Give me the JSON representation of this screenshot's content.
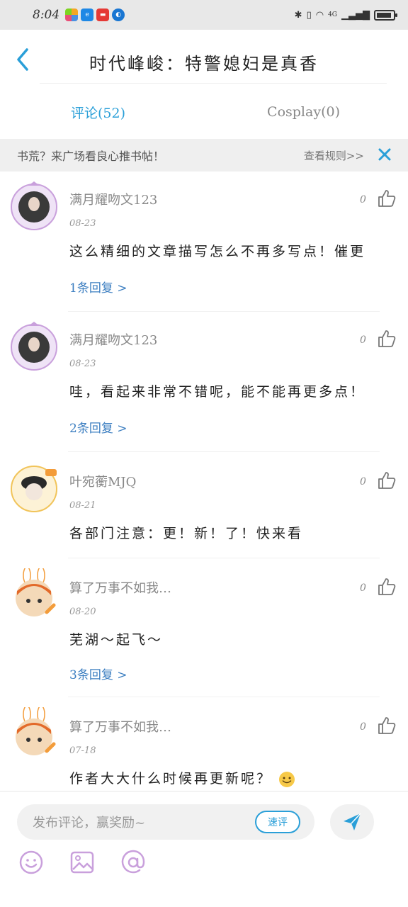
{
  "status_bar": {
    "time": "8:04",
    "network": "4G"
  },
  "header": {
    "title": "时代峰峻：特警媳妇是真香"
  },
  "tabs": [
    {
      "label": "评论(52)",
      "active": true
    },
    {
      "label": "Cosplay(0)",
      "active": false
    }
  ],
  "banner": {
    "text": "书荒？来广场看良心推书帖！",
    "rule_link": "查看规则>>"
  },
  "comments": [
    {
      "name": "满月耀吻文123",
      "date": "08-23",
      "text": "这么精细的文章描写怎么不再多写点！催更",
      "reply": "1条回复 >",
      "likes": "0"
    },
    {
      "name": "满月耀吻文123",
      "date": "08-23",
      "text": "哇，看起来非常不错呢，能不能再更多点！",
      "reply": "2条回复 >",
      "likes": "0"
    },
    {
      "name": "叶宛蘅MJQ",
      "date": "08-21",
      "text": "各部门注意：更！新！了！快来看",
      "reply": "",
      "likes": "0"
    },
    {
      "name": "算了万事不如我…",
      "date": "08-20",
      "text": "芜湖～起飞～",
      "reply": "3条回复 >",
      "likes": "0"
    },
    {
      "name": "算了万事不如我…",
      "date": "07-18",
      "text": "作者大大什么时候再更新呢？",
      "reply": "",
      "likes": "0"
    }
  ],
  "bottom_bar": {
    "input_placeholder": "发布评论，赢奖励~",
    "quick_comment": "速评"
  },
  "colors": {
    "accent": "#2a9fd8",
    "reply_link": "#3d7fc1",
    "icon_purple": "#c9a0dc"
  }
}
